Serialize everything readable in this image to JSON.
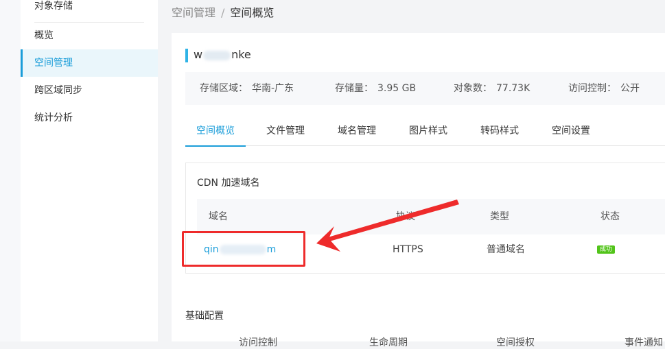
{
  "sidebar": {
    "top_item": "对象存储",
    "items": [
      {
        "label": "概览"
      },
      {
        "label": "空间管理"
      },
      {
        "label": "跨区域同步"
      },
      {
        "label": "统计分析"
      }
    ]
  },
  "breadcrumb": {
    "parent": "空间管理",
    "separator": "/",
    "current": "空间概览"
  },
  "bucket": {
    "name_prefix": "w",
    "name_suffix": "nke"
  },
  "info": {
    "region_label": "存储区域：",
    "region_value": "华南-广东",
    "storage_label": "存储量：",
    "storage_value": "3.95 GB",
    "objects_label": "对象数：",
    "objects_value": "77.73K",
    "access_label": "访问控制：",
    "access_value": "公开"
  },
  "tabs": [
    {
      "label": "空间概览"
    },
    {
      "label": "文件管理"
    },
    {
      "label": "域名管理"
    },
    {
      "label": "图片样式"
    },
    {
      "label": "转码样式"
    },
    {
      "label": "空间设置"
    }
  ],
  "cdn": {
    "title": "CDN 加速域名",
    "headers": [
      "域名",
      "协议",
      "类型",
      "状态"
    ],
    "row": {
      "domain_prefix": "qin",
      "domain_suffix": "m",
      "protocol": "HTTPS",
      "type": "普通域名",
      "status": "成功"
    }
  },
  "basic_config": {
    "title": "基础配置",
    "items": [
      "访问控制",
      "生命周期",
      "空间授权",
      "事件通知"
    ]
  },
  "colors": {
    "accent": "#1a9dd9",
    "success": "#52c41a",
    "annotation": "#ee2b2b"
  }
}
